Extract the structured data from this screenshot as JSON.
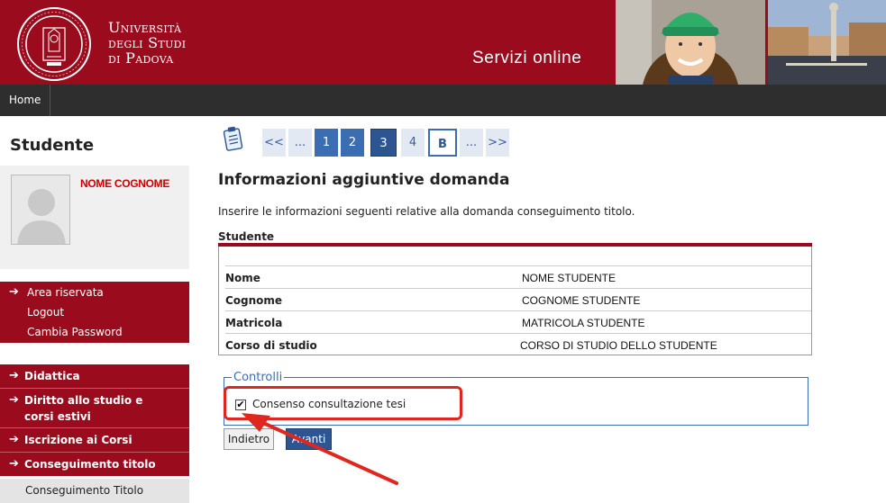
{
  "header": {
    "university_lines": [
      "Università",
      "degli Studi",
      "di Padova"
    ],
    "service_title": "Servizi online"
  },
  "nav": {
    "home_label": "Home"
  },
  "sidebar": {
    "title": "Studente",
    "profile_name": "NOME COGNOME",
    "reserved_area": [
      "Area riservata",
      "Logout",
      "Cambia Password"
    ],
    "menu": [
      "Didattica",
      "Diritto allo studio e corsi estivi",
      "Iscrizione ai Corsi",
      "Conseguimento titolo"
    ],
    "sub_item": "Conseguimento Titolo"
  },
  "pager": {
    "first": "<<",
    "ellipsis_left": "...",
    "pages": [
      "1",
      "2",
      "3",
      "4"
    ],
    "current_page": "3",
    "bookmark": "B",
    "ellipsis_right": "...",
    "last": ">>"
  },
  "main": {
    "title": "Informazioni aggiuntive domanda",
    "intro": "Inserire le informazioni seguenti relative alla domanda conseguimento titolo.",
    "section_title": "Studente",
    "rows": [
      {
        "label": "Nome",
        "value": "NOME STUDENTE"
      },
      {
        "label": "Cognome",
        "value": "COGNOME STUDENTE"
      },
      {
        "label": "Matricola",
        "value": "MATRICOLA STUDENTE"
      },
      {
        "label": "Corso di studio",
        "value": "CORSO DI STUDIO DELLO STUDENTE"
      }
    ],
    "fieldset_legend": "Controlli",
    "checkbox_label": "Consenso consultazione tesi",
    "checkbox_checked": true,
    "back_button": "Indietro",
    "next_button": "Avanti"
  },
  "colors": {
    "brand_red": "#9b0b1e",
    "annotation_red": "#e0271f",
    "link_blue": "#3b6db3"
  }
}
